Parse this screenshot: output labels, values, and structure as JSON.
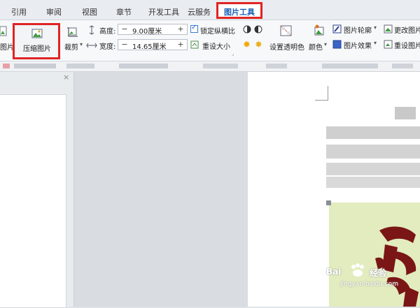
{
  "tabs": [
    {
      "label": "引用"
    },
    {
      "label": "审阅"
    },
    {
      "label": "视图"
    },
    {
      "label": "章节"
    },
    {
      "label": "开发工具"
    },
    {
      "label": "云服务"
    },
    {
      "label": "图片工具"
    }
  ],
  "ribbon": {
    "partial_label": "图片",
    "compress_label": "压缩图片",
    "crop_label": "裁剪",
    "height_label": "高度:",
    "height_value": "9.00厘米",
    "width_label": "宽度:",
    "width_value": "14.65厘米",
    "lock_ratio_label": "锁定纵横比",
    "lock_ratio_checked": true,
    "reset_size_label": "重设大小",
    "set_transparent_label": "设置透明色",
    "color_label": "颜色",
    "outline_label": "图片轮廓",
    "effect_label": "图片效果",
    "change_pic_label": "更改图片",
    "reset_pic_label": "重设图片"
  },
  "watermark": {
    "brand": "Bai",
    "brand_suffix": "经验",
    "url": "jingyan.baidu.com"
  },
  "colors": {
    "highlight": "#e02424",
    "active_tab_text": "#1a5fb4",
    "picture_bg": "#e2ecbe",
    "calligraphy": "#7a1616"
  }
}
